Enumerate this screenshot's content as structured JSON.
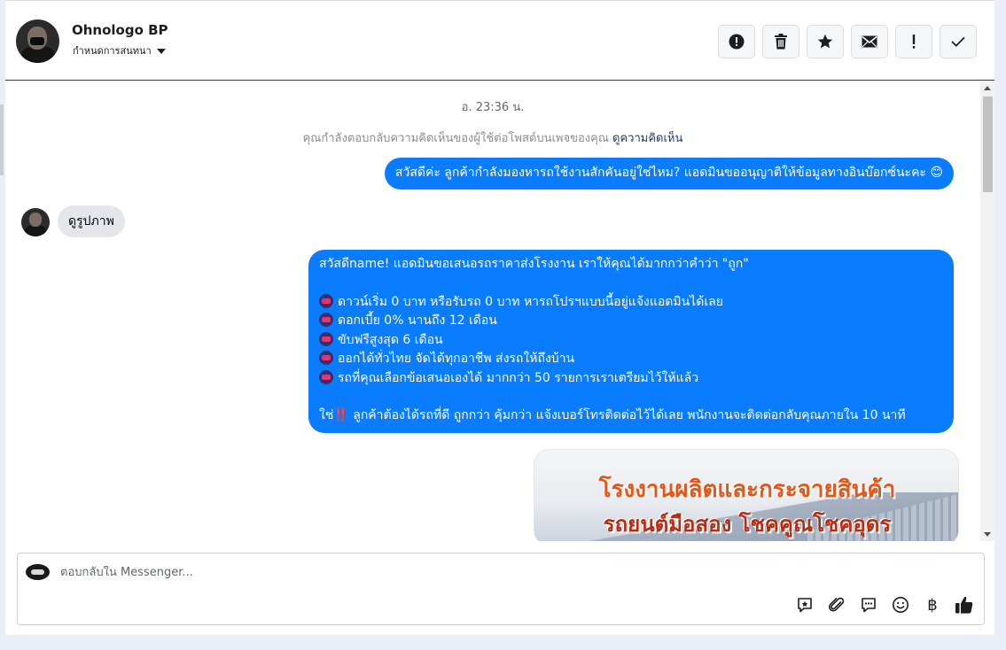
{
  "header": {
    "contact_name": "Ohnologo BP",
    "sub_label": "กำหนดการสนทนา",
    "actions": [
      {
        "name": "report-button",
        "glyph": "!"
      },
      {
        "name": "delete-button",
        "glyph": "🗑"
      },
      {
        "name": "star-button",
        "glyph": "★"
      },
      {
        "name": "mail-button",
        "glyph": "✉"
      },
      {
        "name": "important-button",
        "glyph": "!"
      },
      {
        "name": "done-button",
        "glyph": "✓"
      }
    ]
  },
  "chat": {
    "timestamp": "อ. 23:36 น.",
    "context_text": "คุณกำลังตอบกลับความคิดเห็นของผู้ใช้ต่อโพสต์บนเพจของคุณ",
    "context_link": "ดูความคิดเห็น",
    "msg1": "สวัสดีค่ะ ลูกค้ากำลังมองหารถใช้งานสักคันอยู่ใช่ไหม? แอดมินขออนุญาติให้ข้อมูลทางอินบ๊อกซ์นะคะ 😊",
    "incoming": "ดูรูปภาพ",
    "msg2_intro": "สวัสดีname! แอดมินขอเสนอรถราคาส่งโรงงาน เราให้คุณได้มากกว่าคำว่า \"ถูก\"",
    "msg2_items": [
      "ดาวน์เริ่ม 0 บาท หรือรับรถ 0 บาท หารถโปรฯแบบนี้อยู่แจ้งแอดมินได้เลย",
      "ดอกเบี้ย 0% นานถึง 12 เดือน",
      "ขับฟรีสูงสุด 6 เดือน",
      "ออกได้ทั่วไทย จัดได้ทุกอาชีพ ส่งรถให้ถึงบ้าน",
      "รถที่คุณเลือกข้อเสนอเองได้ มากกว่า 50 รายการเราเตรียมไว้ให้แล้ว"
    ],
    "msg2_outro_pre": "ใช่",
    "msg2_outro_mark": "‼️",
    "msg2_outro_post": "ลูกค้าต้องได้รถที่ดี ถูกกว่า คุ้มกว่า แจ้งเบอร์โทรติดต่อไว้ได้เลย พนักงานจะติดต่อกลับคุณภายใน 10 นาที",
    "image_line1": "โรงงานผลิตและกระจายสินค้า",
    "image_line2": "รถยนต์มือสอง โชคคูณโชคอุดร"
  },
  "composer": {
    "placeholder": "ตอบกลับใน Messenger...",
    "baht_glyph": "฿"
  }
}
